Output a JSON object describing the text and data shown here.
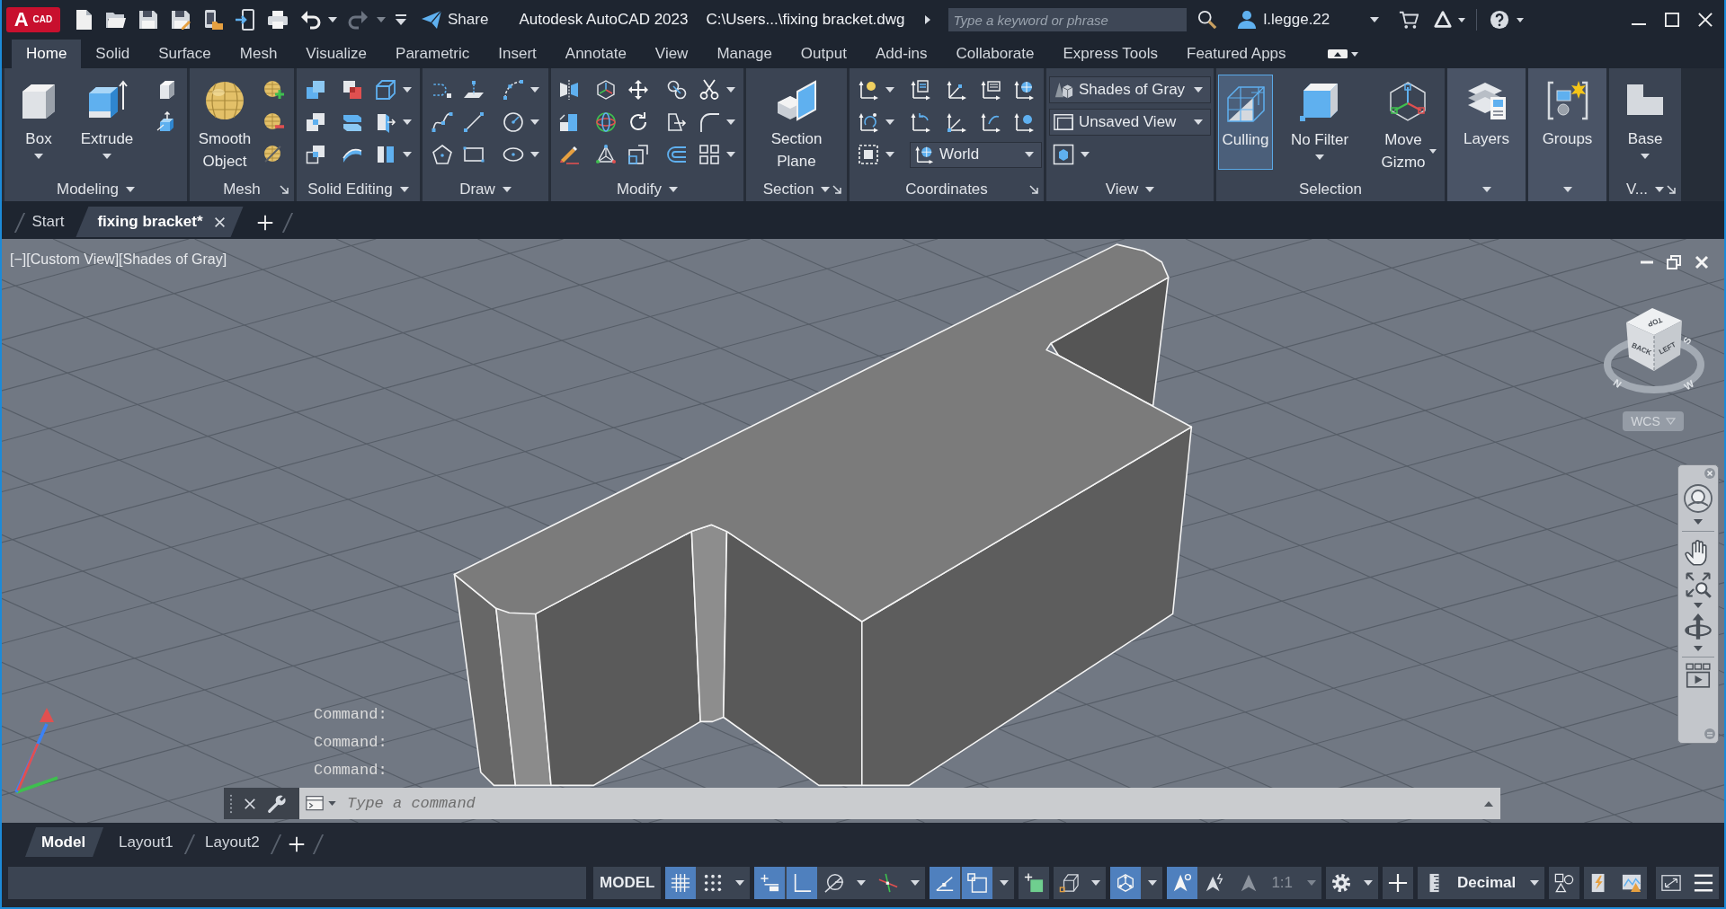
{
  "title_bar": {
    "app_button": {
      "letter": "A",
      "label": "CAD"
    },
    "undo": {
      "disabled": false
    },
    "redo": {
      "disabled": true
    },
    "share": "Share",
    "app_name": "Autodesk AutoCAD 2023",
    "file_path": "C:\\Users...\\fixing bracket.dwg",
    "search": {
      "placeholder": "Type a keyword or phrase"
    },
    "user": "l.legge.22"
  },
  "ribbon_tabs": [
    {
      "label": "Home",
      "selected": true
    },
    {
      "label": "Solid",
      "selected": false
    },
    {
      "label": "Surface",
      "selected": false
    },
    {
      "label": "Mesh",
      "selected": false
    },
    {
      "label": "Visualize",
      "selected": false
    },
    {
      "label": "Parametric",
      "selected": false
    },
    {
      "label": "Insert",
      "selected": false
    },
    {
      "label": "Annotate",
      "selected": false
    },
    {
      "label": "View",
      "selected": false
    },
    {
      "label": "Manage",
      "selected": false
    },
    {
      "label": "Output",
      "selected": false
    },
    {
      "label": "Add-ins",
      "selected": false
    },
    {
      "label": "Collaborate",
      "selected": false
    },
    {
      "label": "Express Tools",
      "selected": false
    },
    {
      "label": "Featured Apps",
      "selected": false
    }
  ],
  "ribbon_panels": [
    {
      "kind": "modeling",
      "label": "Modeling",
      "dropdown": true,
      "launcher": false,
      "buttons": [
        {
          "label": "Box",
          "dropdown": true
        },
        {
          "label": "Extrude",
          "dropdown": true
        }
      ]
    },
    {
      "kind": "mesh",
      "label": "Mesh",
      "dropdown": false,
      "launcher": true,
      "buttons": [
        {
          "label": "Smooth Object",
          "dropdown": false
        }
      ]
    },
    {
      "kind": "solidedit",
      "label": "Solid Editing",
      "dropdown": true,
      "launcher": false
    },
    {
      "kind": "draw",
      "label": "Draw",
      "dropdown": true,
      "launcher": false
    },
    {
      "kind": "modify",
      "label": "Modify",
      "dropdown": true,
      "launcher": false
    },
    {
      "kind": "section",
      "label": "Section",
      "dropdown": true,
      "launcher": true,
      "buttons": [
        {
          "label": "Section Plane",
          "dropdown": false
        }
      ]
    },
    {
      "kind": "coordinates",
      "label": "Coordinates",
      "dropdown": false,
      "launcher": true,
      "dropdowns": [
        "World"
      ]
    },
    {
      "kind": "view",
      "label": "View",
      "dropdown": true,
      "launcher": false,
      "dropdowns": [
        "Shades of Gray",
        "Unsaved View"
      ]
    },
    {
      "kind": "selection",
      "label": "Selection",
      "dropdown": false,
      "launcher": false,
      "buttons": [
        {
          "label": "Culling",
          "dropdown": false,
          "on": true
        },
        {
          "label": "No Filter",
          "dropdown": true,
          "on": false
        },
        {
          "label": "Move Gizmo",
          "dropdown": true,
          "on": false
        }
      ]
    },
    {
      "kind": "layers",
      "dropdown": true,
      "launcher": false,
      "buttons": [
        {
          "label": "Layers",
          "dropdown": false
        }
      ]
    },
    {
      "kind": "groups",
      "dropdown": true,
      "launcher": false,
      "buttons": [
        {
          "label": "Groups",
          "dropdown": false
        }
      ]
    },
    {
      "kind": "base",
      "label": "V...",
      "dropdown": true,
      "launcher": true,
      "buttons": [
        {
          "label": "Base",
          "dropdown": true
        }
      ]
    }
  ],
  "file_tabs": [
    {
      "label": "Start",
      "selected": false
    },
    {
      "label": "fixing bracket*",
      "selected": true
    }
  ],
  "viewport": {
    "view_controls": [
      "[−]",
      "[Custom View]",
      "[Shades of Gray]"
    ],
    "viewcube": {
      "faces": [
        "TOP",
        "BACK",
        "LEFT"
      ],
      "compass": [
        "N",
        "W",
        "S"
      ]
    },
    "ucs_menu": "WCS",
    "command_history": [
      "Command:",
      "Command:",
      "Command:"
    ],
    "command_line": {
      "placeholder": "Type a command"
    }
  },
  "layout_tabs": [
    {
      "label": "Model",
      "selected": true
    },
    {
      "label": "Layout1",
      "selected": false
    },
    {
      "label": "Layout2",
      "selected": false
    }
  ],
  "status_bar": {
    "space": "MODEL",
    "groups": [
      [
        {
          "kind": "grid",
          "on": true,
          "dropdown": false
        },
        {
          "kind": "snap",
          "on": false,
          "dropdown": true
        }
      ],
      [
        {
          "kind": "infer",
          "on": true,
          "dropdown": false
        },
        {
          "kind": "ortho",
          "on": true,
          "dropdown": false
        },
        {
          "kind": "polar",
          "on": false,
          "dropdown": true
        },
        {
          "kind": "isodraft",
          "on": false,
          "dropdown": true
        }
      ],
      [
        {
          "kind": "tracking",
          "on": true,
          "dropdown": false
        },
        {
          "kind": "osnap",
          "on": true,
          "dropdown": true
        }
      ],
      [
        {
          "kind": "transparency",
          "on": false,
          "dropdown": false
        }
      ],
      [
        {
          "kind": "osnap3d",
          "on": false,
          "dropdown": true
        }
      ],
      [
        {
          "kind": "gizmo",
          "on": true,
          "dropdown": true
        }
      ],
      [
        {
          "kind": "annovis",
          "on": true,
          "dropdown": false
        },
        {
          "kind": "autoscale",
          "on": false,
          "dropdown": false
        },
        {
          "kind": "annoscale",
          "on": false,
          "dropdown": true,
          "label": "1:1"
        }
      ],
      [
        {
          "kind": "workspace",
          "on": false,
          "dropdown": true
        }
      ],
      [
        {
          "kind": "monitor",
          "on": false,
          "dropdown": false
        }
      ],
      [
        {
          "kind": "units",
          "on": false,
          "dropdown": true,
          "label": "Decimal"
        }
      ],
      [
        {
          "kind": "quickprops",
          "on": false,
          "dropdown": false
        }
      ],
      [
        {
          "kind": "isolate",
          "on": false,
          "dropdown": false
        },
        {
          "kind": "performance",
          "on": false,
          "dropdown": false
        }
      ],
      [
        {
          "kind": "fullscreen",
          "on": false,
          "dropdown": false
        },
        {
          "kind": "customize",
          "on": false,
          "dropdown": false
        }
      ]
    ]
  }
}
